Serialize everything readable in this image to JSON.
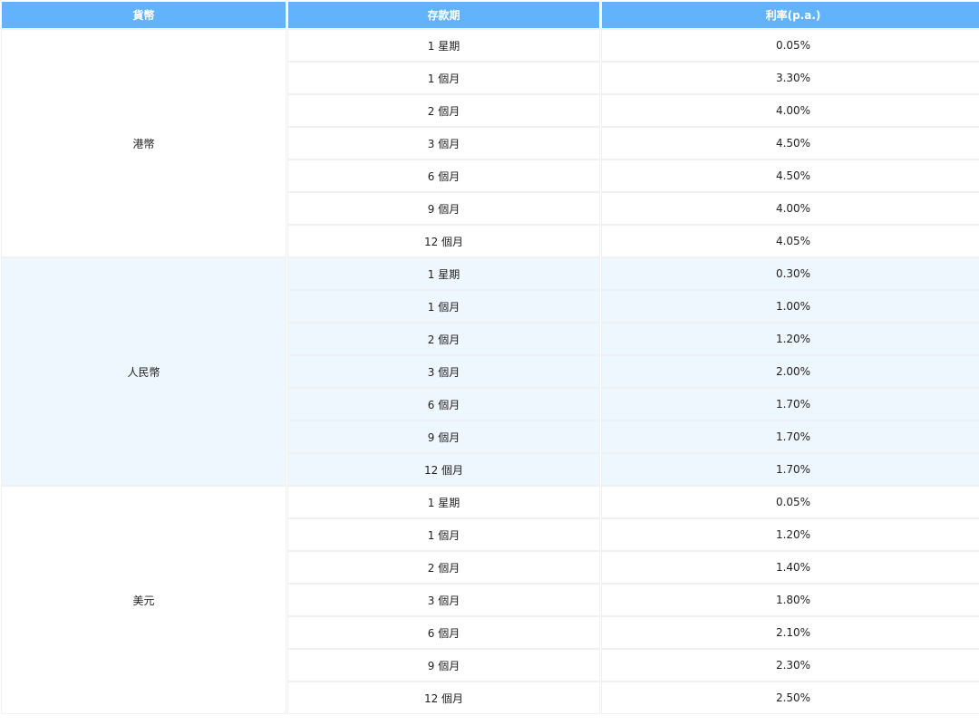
{
  "table": {
    "headers": {
      "currency": "貨幣",
      "term": "存款期",
      "rate": "利率(p.a.)"
    },
    "groups": [
      {
        "currency": "港幣",
        "style": "white",
        "rows": [
          {
            "term": "1 星期",
            "rate": "0.05%"
          },
          {
            "term": "1 個月",
            "rate": "3.30%"
          },
          {
            "term": "2 個月",
            "rate": "4.00%"
          },
          {
            "term": "3 個月",
            "rate": "4.50%"
          },
          {
            "term": "6 個月",
            "rate": "4.50%"
          },
          {
            "term": "9 個月",
            "rate": "4.00%"
          },
          {
            "term": "12 個月",
            "rate": "4.05%"
          }
        ]
      },
      {
        "currency": "人民幣",
        "style": "blue",
        "rows": [
          {
            "term": "1 星期",
            "rate": "0.30%"
          },
          {
            "term": "1 個月",
            "rate": "1.00%"
          },
          {
            "term": "2 個月",
            "rate": "1.20%"
          },
          {
            "term": "3 個月",
            "rate": "2.00%"
          },
          {
            "term": "6 個月",
            "rate": "1.70%"
          },
          {
            "term": "9 個月",
            "rate": "1.70%"
          },
          {
            "term": "12 個月",
            "rate": "1.70%"
          }
        ]
      },
      {
        "currency": "美元",
        "style": "white",
        "rows": [
          {
            "term": "1 星期",
            "rate": "0.05%"
          },
          {
            "term": "1 個月",
            "rate": "1.20%"
          },
          {
            "term": "2 個月",
            "rate": "1.40%"
          },
          {
            "term": "3 個月",
            "rate": "1.80%"
          },
          {
            "term": "6 個月",
            "rate": "2.10%"
          },
          {
            "term": "9 個月",
            "rate": "2.30%"
          },
          {
            "term": "12 個月",
            "rate": "2.50%"
          }
        ]
      }
    ]
  },
  "colors": {
    "header_bg": "#61b3fb",
    "header_text": "#ffffff",
    "alt_group_bg": "#eef6fe",
    "cell_border": "#eef0f3"
  }
}
